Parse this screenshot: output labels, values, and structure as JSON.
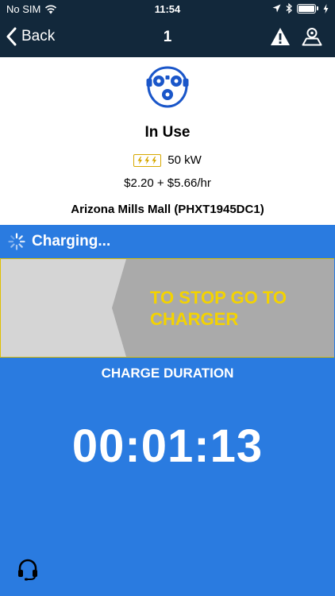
{
  "status_bar": {
    "carrier": "No SIM",
    "time": "11:54"
  },
  "nav": {
    "back_label": "Back",
    "title": "1"
  },
  "station": {
    "status": "In Use",
    "power": "50 kW",
    "price": "$2.20 + $5.66/hr",
    "location": "Arizona Mills Mall (PHXT1945DC1)"
  },
  "session": {
    "status": "Charging...",
    "stop_instruction": "TO STOP GO TO CHARGER",
    "duration_label": "CHARGE DURATION",
    "duration": "00:01:13"
  },
  "colors": {
    "nav_bg": "#12283b",
    "accent_blue": "#2a7be0",
    "connector_blue": "#1a56c9",
    "warning_yellow": "#f4d300"
  }
}
